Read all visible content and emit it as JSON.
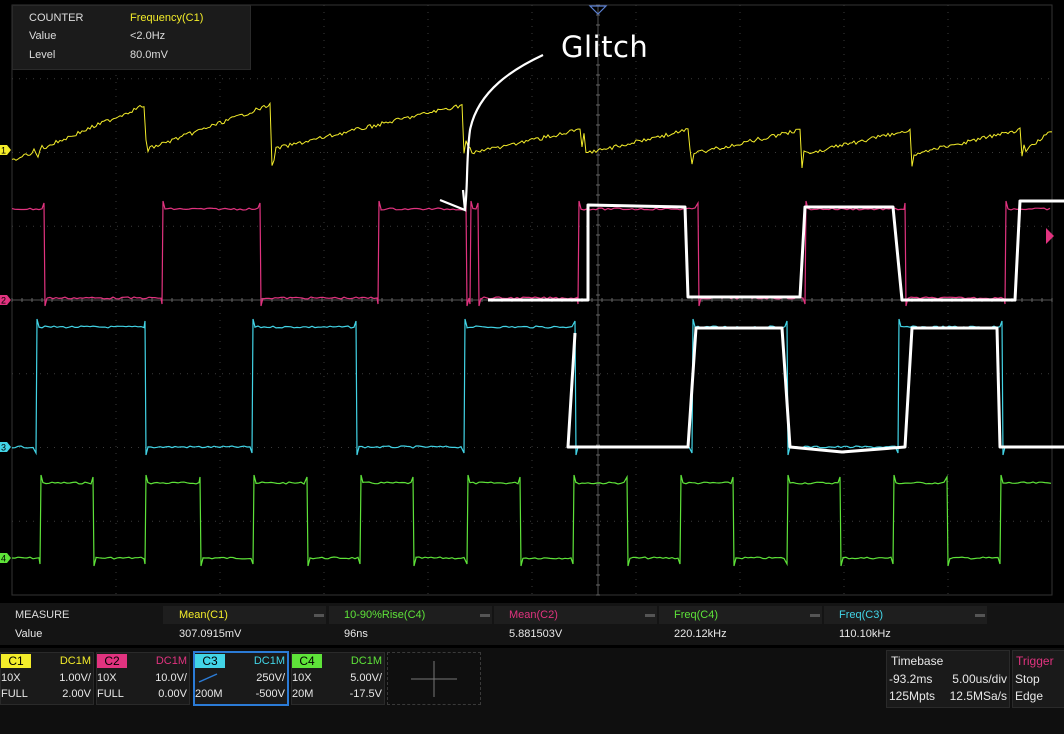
{
  "counter": {
    "title": "COUNTER",
    "source": "Frequency(C1)",
    "value_label": "Value",
    "value": "<2.0Hz",
    "level_label": "Level",
    "level": "80.0mV"
  },
  "annotation": {
    "text": "Glitch"
  },
  "colors": {
    "c1": "#f3ec2a",
    "c2": "#e1337f",
    "c3": "#42d4e6",
    "c4": "#5ee339",
    "annotation": "#ffffff",
    "grid": "#3a3a3a",
    "selected": "#2b7bd6"
  },
  "waveform_markers": {
    "c1": "1",
    "c2": "2",
    "c3": "3",
    "c4": "4"
  },
  "measure": {
    "title": "MEASURE",
    "row_label": "Value",
    "items": [
      {
        "name": "Mean(C1)",
        "value": "307.0915mV"
      },
      {
        "name": "10-90%Rise(C4)",
        "value": "96ns"
      },
      {
        "name": "Mean(C2)",
        "value": "5.881503V"
      },
      {
        "name": "Freq(C4)",
        "value": "220.12kHz"
      },
      {
        "name": "Freq(C3)",
        "value": "110.10kHz"
      }
    ]
  },
  "channels": [
    {
      "tag": "C1",
      "coupling": "DC1M",
      "probe": "10X",
      "scale": "1.00V/",
      "bw": "FULL",
      "offset": "2.00V"
    },
    {
      "tag": "C2",
      "coupling": "DC1M",
      "probe": "10X",
      "scale": "10.0V/",
      "bw": "FULL",
      "offset": "0.00V"
    },
    {
      "tag": "C3",
      "coupling": "DC1M",
      "probe": "",
      "scale": "250V/",
      "bw": "200M",
      "offset": "-500V"
    },
    {
      "tag": "C4",
      "coupling": "DC1M",
      "probe": "10X",
      "scale": "5.00V/",
      "bw": "20M",
      "offset": "-17.5V"
    }
  ],
  "timebase": {
    "title": "Timebase",
    "delay": "-93.2ms",
    "scale": "5.00us/div",
    "memory": "125Mpts",
    "sample_rate": "12.5MSa/s"
  },
  "trigger": {
    "title": "Trigger",
    "state": "Stop",
    "type": "Edge"
  }
}
